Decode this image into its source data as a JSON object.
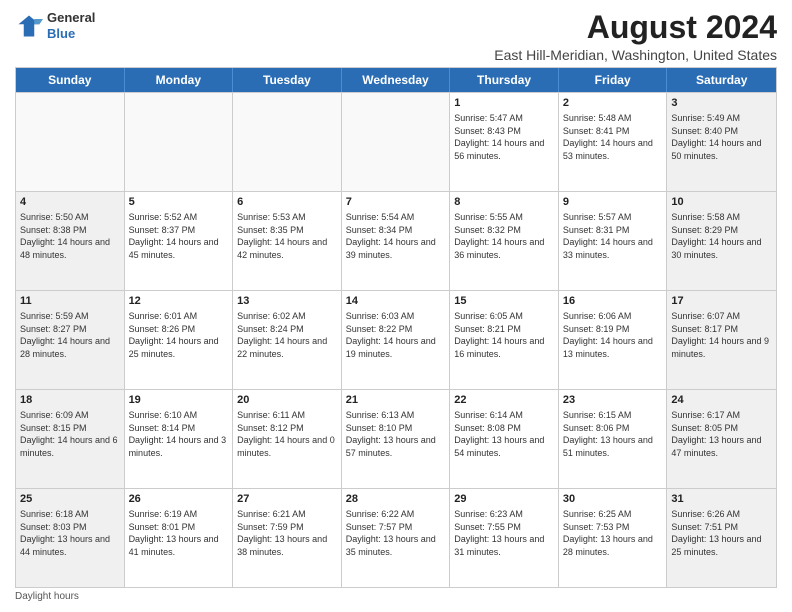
{
  "logo": {
    "general": "General",
    "blue": "Blue"
  },
  "title": "August 2024",
  "location": "East Hill-Meridian, Washington, United States",
  "days_of_week": [
    "Sunday",
    "Monday",
    "Tuesday",
    "Wednesday",
    "Thursday",
    "Friday",
    "Saturday"
  ],
  "footer": "Daylight hours",
  "weeks": [
    [
      {
        "num": "",
        "info": "",
        "empty": true
      },
      {
        "num": "",
        "info": "",
        "empty": true
      },
      {
        "num": "",
        "info": "",
        "empty": true
      },
      {
        "num": "",
        "info": "",
        "empty": true
      },
      {
        "num": "1",
        "info": "Sunrise: 5:47 AM\nSunset: 8:43 PM\nDaylight: 14 hours\nand 56 minutes.",
        "empty": false
      },
      {
        "num": "2",
        "info": "Sunrise: 5:48 AM\nSunset: 8:41 PM\nDaylight: 14 hours\nand 53 minutes.",
        "empty": false
      },
      {
        "num": "3",
        "info": "Sunrise: 5:49 AM\nSunset: 8:40 PM\nDaylight: 14 hours\nand 50 minutes.",
        "empty": false,
        "shaded": true
      }
    ],
    [
      {
        "num": "4",
        "info": "Sunrise: 5:50 AM\nSunset: 8:38 PM\nDaylight: 14 hours\nand 48 minutes.",
        "empty": false,
        "shaded": true
      },
      {
        "num": "5",
        "info": "Sunrise: 5:52 AM\nSunset: 8:37 PM\nDaylight: 14 hours\nand 45 minutes.",
        "empty": false
      },
      {
        "num": "6",
        "info": "Sunrise: 5:53 AM\nSunset: 8:35 PM\nDaylight: 14 hours\nand 42 minutes.",
        "empty": false
      },
      {
        "num": "7",
        "info": "Sunrise: 5:54 AM\nSunset: 8:34 PM\nDaylight: 14 hours\nand 39 minutes.",
        "empty": false
      },
      {
        "num": "8",
        "info": "Sunrise: 5:55 AM\nSunset: 8:32 PM\nDaylight: 14 hours\nand 36 minutes.",
        "empty": false
      },
      {
        "num": "9",
        "info": "Sunrise: 5:57 AM\nSunset: 8:31 PM\nDaylight: 14 hours\nand 33 minutes.",
        "empty": false
      },
      {
        "num": "10",
        "info": "Sunrise: 5:58 AM\nSunset: 8:29 PM\nDaylight: 14 hours\nand 30 minutes.",
        "empty": false,
        "shaded": true
      }
    ],
    [
      {
        "num": "11",
        "info": "Sunrise: 5:59 AM\nSunset: 8:27 PM\nDaylight: 14 hours\nand 28 minutes.",
        "empty": false,
        "shaded": true
      },
      {
        "num": "12",
        "info": "Sunrise: 6:01 AM\nSunset: 8:26 PM\nDaylight: 14 hours\nand 25 minutes.",
        "empty": false
      },
      {
        "num": "13",
        "info": "Sunrise: 6:02 AM\nSunset: 8:24 PM\nDaylight: 14 hours\nand 22 minutes.",
        "empty": false
      },
      {
        "num": "14",
        "info": "Sunrise: 6:03 AM\nSunset: 8:22 PM\nDaylight: 14 hours\nand 19 minutes.",
        "empty": false
      },
      {
        "num": "15",
        "info": "Sunrise: 6:05 AM\nSunset: 8:21 PM\nDaylight: 14 hours\nand 16 minutes.",
        "empty": false
      },
      {
        "num": "16",
        "info": "Sunrise: 6:06 AM\nSunset: 8:19 PM\nDaylight: 14 hours\nand 13 minutes.",
        "empty": false
      },
      {
        "num": "17",
        "info": "Sunrise: 6:07 AM\nSunset: 8:17 PM\nDaylight: 14 hours\nand 9 minutes.",
        "empty": false,
        "shaded": true
      }
    ],
    [
      {
        "num": "18",
        "info": "Sunrise: 6:09 AM\nSunset: 8:15 PM\nDaylight: 14 hours\nand 6 minutes.",
        "empty": false,
        "shaded": true
      },
      {
        "num": "19",
        "info": "Sunrise: 6:10 AM\nSunset: 8:14 PM\nDaylight: 14 hours\nand 3 minutes.",
        "empty": false
      },
      {
        "num": "20",
        "info": "Sunrise: 6:11 AM\nSunset: 8:12 PM\nDaylight: 14 hours\nand 0 minutes.",
        "empty": false
      },
      {
        "num": "21",
        "info": "Sunrise: 6:13 AM\nSunset: 8:10 PM\nDaylight: 13 hours\nand 57 minutes.",
        "empty": false
      },
      {
        "num": "22",
        "info": "Sunrise: 6:14 AM\nSunset: 8:08 PM\nDaylight: 13 hours\nand 54 minutes.",
        "empty": false
      },
      {
        "num": "23",
        "info": "Sunrise: 6:15 AM\nSunset: 8:06 PM\nDaylight: 13 hours\nand 51 minutes.",
        "empty": false
      },
      {
        "num": "24",
        "info": "Sunrise: 6:17 AM\nSunset: 8:05 PM\nDaylight: 13 hours\nand 47 minutes.",
        "empty": false,
        "shaded": true
      }
    ],
    [
      {
        "num": "25",
        "info": "Sunrise: 6:18 AM\nSunset: 8:03 PM\nDaylight: 13 hours\nand 44 minutes.",
        "empty": false,
        "shaded": true
      },
      {
        "num": "26",
        "info": "Sunrise: 6:19 AM\nSunset: 8:01 PM\nDaylight: 13 hours\nand 41 minutes.",
        "empty": false
      },
      {
        "num": "27",
        "info": "Sunrise: 6:21 AM\nSunset: 7:59 PM\nDaylight: 13 hours\nand 38 minutes.",
        "empty": false
      },
      {
        "num": "28",
        "info": "Sunrise: 6:22 AM\nSunset: 7:57 PM\nDaylight: 13 hours\nand 35 minutes.",
        "empty": false
      },
      {
        "num": "29",
        "info": "Sunrise: 6:23 AM\nSunset: 7:55 PM\nDaylight: 13 hours\nand 31 minutes.",
        "empty": false
      },
      {
        "num": "30",
        "info": "Sunrise: 6:25 AM\nSunset: 7:53 PM\nDaylight: 13 hours\nand 28 minutes.",
        "empty": false
      },
      {
        "num": "31",
        "info": "Sunrise: 6:26 AM\nSunset: 7:51 PM\nDaylight: 13 hours\nand 25 minutes.",
        "empty": false,
        "shaded": true
      }
    ]
  ]
}
